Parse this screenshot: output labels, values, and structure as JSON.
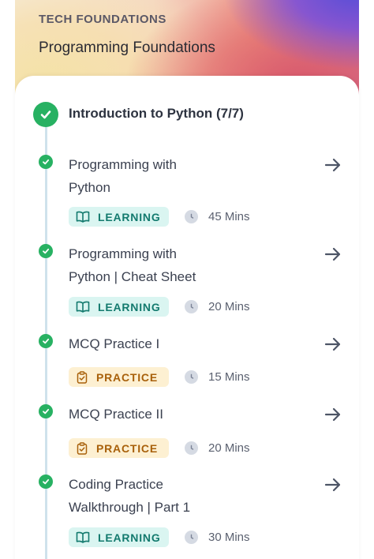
{
  "header": {
    "category": "TECH FOUNDATIONS",
    "course_title": "Programming Foundations"
  },
  "module": {
    "title": "Introduction to Python (7/7)",
    "status": "completed"
  },
  "items": [
    {
      "title_line1": "Programming with",
      "title_line2": "Python",
      "type": "LEARNING",
      "duration": "45 Mins",
      "status": "completed"
    },
    {
      "title_line1": "Programming with",
      "title_line2": "Python | Cheat Sheet",
      "type": "LEARNING",
      "duration": "20 Mins",
      "status": "completed"
    },
    {
      "title_line1": "MCQ Practice I",
      "title_line2": "",
      "type": "PRACTICE",
      "duration": "15 Mins",
      "status": "completed"
    },
    {
      "title_line1": "MCQ Practice II",
      "title_line2": "",
      "type": "PRACTICE",
      "duration": "20 Mins",
      "status": "completed"
    },
    {
      "title_line1": "Coding Practice",
      "title_line2": "Walkthrough | Part 1",
      "type": "LEARNING",
      "duration": "30 Mins",
      "status": "completed"
    }
  ],
  "icons": {
    "completed": "check-circle-icon",
    "learning": "book-open-icon",
    "practice": "clipboard-check-icon",
    "duration": "clock-icon",
    "open": "arrow-right-icon"
  },
  "colors": {
    "success": "#27b162",
    "learning_bg": "#daf5f1",
    "learning_text": "#137a6e",
    "practice_bg": "#fdf0d2",
    "practice_text": "#a8600a"
  }
}
